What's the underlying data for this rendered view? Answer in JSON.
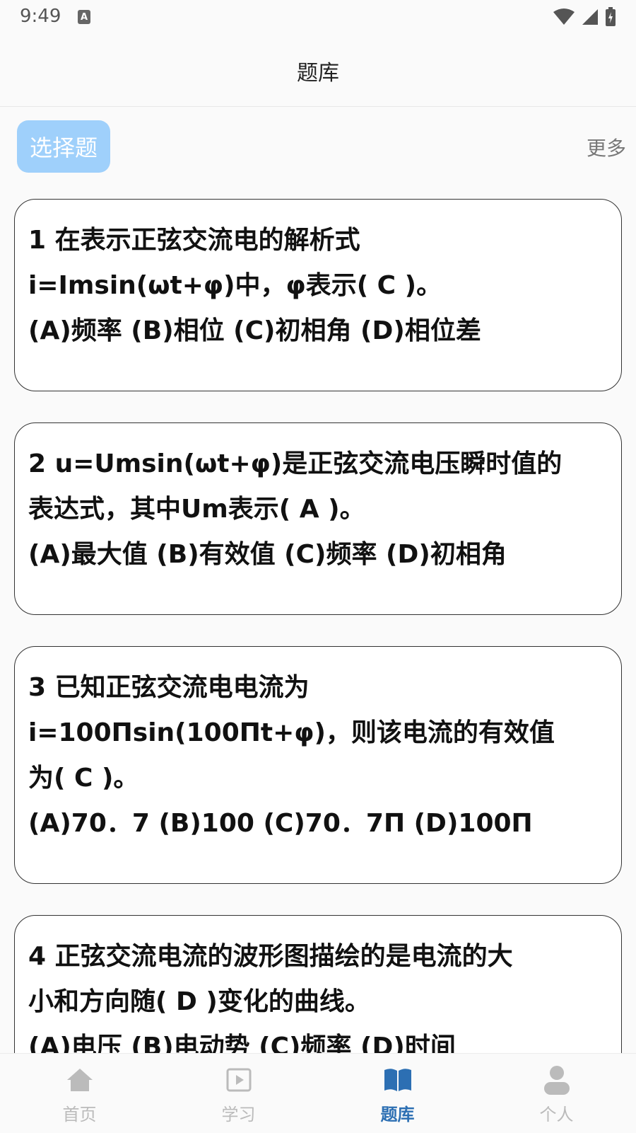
{
  "status": {
    "time": "9:49",
    "indicator": "A"
  },
  "header": {
    "title": "题库"
  },
  "section": {
    "tag": "选择题",
    "more": "更多"
  },
  "questions": [
    {
      "lines": [
        "1 在表示正弦交流电的解析式",
        "i=Imsin(ωt+φ)中，φ表示( C )。",
        "(A)频率 (B)相位 (C)初相角 (D)相位差"
      ]
    },
    {
      "lines": [
        "2 u=Umsin(ωt+φ)是正弦交流电压瞬时值的",
        "表达式，其中Um表示( A )。",
        "(A)最大值 (B)有效值 (C)频率 (D)初相角"
      ]
    },
    {
      "lines": [
        "3 已知正弦交流电电流为",
        "i=100Πsin(100Πt+φ)，则该电流的有效值",
        "为( C )。",
        "(A)70．7 (B)100 (C)70．7Π (D)100Π"
      ]
    },
    {
      "lines": [
        "4 正弦交流电流的波形图描绘的是电流的大",
        "小和方向随( D )变化的曲线。",
        "(A)电压 (B)电动势 (C)频率 (D)时间"
      ]
    }
  ],
  "tabs": [
    {
      "label": "首页",
      "icon": "home-icon"
    },
    {
      "label": "学习",
      "icon": "play-icon"
    },
    {
      "label": "题库",
      "icon": "book-icon",
      "active": true
    },
    {
      "label": "个人",
      "icon": "person-icon"
    }
  ],
  "colors": {
    "accent": "#2c6fb3",
    "tag_bg": "#9fd0fb",
    "inactive": "#bbbbbb"
  }
}
